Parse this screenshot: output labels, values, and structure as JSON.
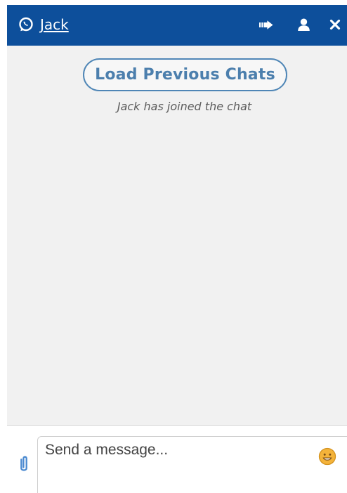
{
  "header": {
    "title": "Jack",
    "background_color": "#0d4f9b",
    "title_icon": "whatsapp-icon",
    "action_icons": [
      "transfer-icon",
      "user-icon",
      "close-icon"
    ]
  },
  "messages": {
    "load_previous_label": "Load Previous Chats",
    "system_message": "Jack has joined the chat",
    "accent_color": "#4f86b6"
  },
  "composer": {
    "placeholder": "Send a message...",
    "attach_icon": "paperclip-icon",
    "emoji_icon": "smiley-icon",
    "emoji_color": "#f4b33a"
  }
}
